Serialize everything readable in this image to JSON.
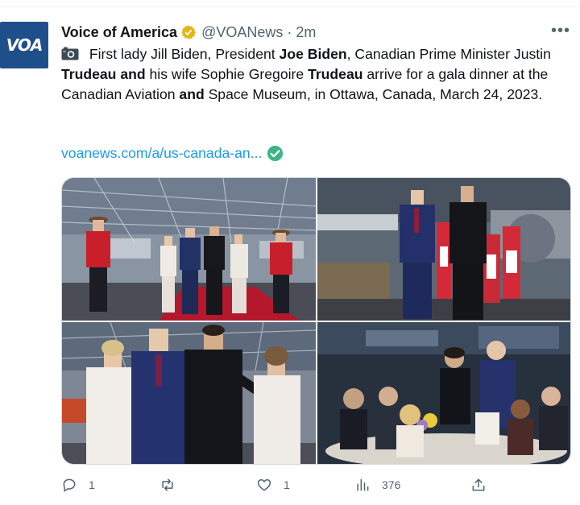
{
  "tweet": {
    "author_name": "Voice of America",
    "handle": "@VOANews",
    "separator": "·",
    "time": "2m",
    "avatar_text": "VOA",
    "more_label": "•••",
    "text_segments": [
      {
        "t": " First lady Jill Biden, President ",
        "b": false
      },
      {
        "t": "Joe Biden",
        "b": true
      },
      {
        "t": ", Canadian Prime Minister Justin ",
        "b": false
      },
      {
        "t": "Trudeau and",
        "b": true
      },
      {
        "t": " his wife Sophie Gregoire ",
        "b": false
      },
      {
        "t": "Trudeau",
        "b": true
      },
      {
        "t": " arrive for a gala dinner at the Canadian Aviation ",
        "b": false
      },
      {
        "t": "and",
        "b": true
      },
      {
        "t": " Space Museum, in Ottawa, Canada, March 24, 2023.",
        "b": false
      }
    ],
    "link_text": "voanews.com/a/us-canada-an...",
    "icons": {
      "verified": "verified-badge-icon",
      "camera": "camera-icon",
      "link_check": "check-circle-icon"
    },
    "colors": {
      "accent": "#1d9bf0",
      "verified_gold": "#e2b719",
      "check_green": "#3eb489",
      "avatar_bg": "#1f4f8a"
    }
  },
  "stats": {
    "replies": "1",
    "retweets": "",
    "likes": "1",
    "views": "376"
  }
}
